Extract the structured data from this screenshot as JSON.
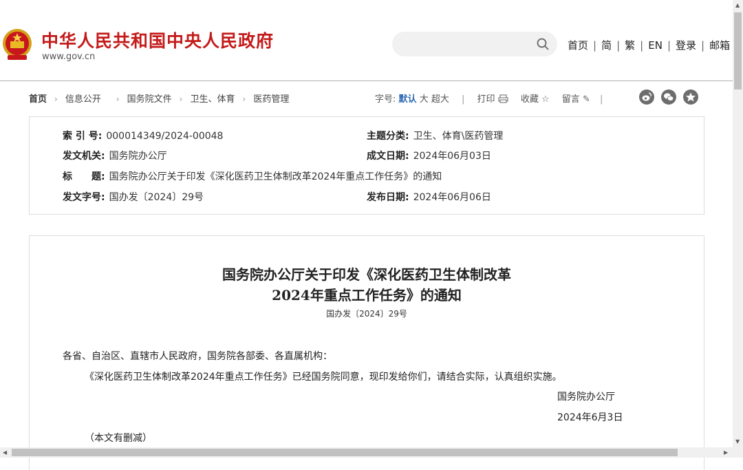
{
  "header": {
    "site_title": "中华人民共和国中央人民政府",
    "site_url": "www.gov.cn",
    "search_placeholder": "",
    "nav": [
      "首页",
      "简",
      "繁",
      "EN",
      "登录",
      "邮箱"
    ]
  },
  "breadcrumb": [
    "首页",
    "信息公开",
    "国务院文件",
    "卫生、体育",
    "医药管理"
  ],
  "tools": {
    "font_label": "字号:",
    "font_default": "默认",
    "font_large": "大",
    "font_xlarge": "超大",
    "print": "打印",
    "favorite": "收藏",
    "comment": "留言"
  },
  "info": {
    "index_label": "索 引 号:",
    "index_value": "000014349/2024-00048",
    "category_label": "主题分类:",
    "category_value": "卫生、体育\\医药管理",
    "issuer_label": "发文机关:",
    "issuer_value": "国务院办公厅",
    "created_label": "成文日期:",
    "created_value": "2024年06月03日",
    "title_label": "标　　题:",
    "title_value": "国务院办公厅关于印发《深化医药卫生体制改革2024年重点工作任务》的通知",
    "docno_label": "发文字号:",
    "docno_value": "国办发〔2024〕29号",
    "published_label": "发布日期:",
    "published_value": "2024年06月06日"
  },
  "document": {
    "title_line1": "国务院办公厅关于印发《深化医药卫生体制改革",
    "title_line2": "2024年重点工作任务》的通知",
    "doc_number": "国办发〔2024〕29号",
    "salutation": "各省、自治区、直辖市人民政府，国务院各部委、各直属机构：",
    "body": "《深化医药卫生体制改革2024年重点工作任务》已经国务院同意，现印发给你们，请结合实际，认真组织实施。",
    "signer": "国务院办公厅",
    "date": "2024年6月3日",
    "note": "（本文有删减）"
  },
  "colors": {
    "brand_red": "#c41a1a",
    "link_blue": "#2d6bb3"
  }
}
